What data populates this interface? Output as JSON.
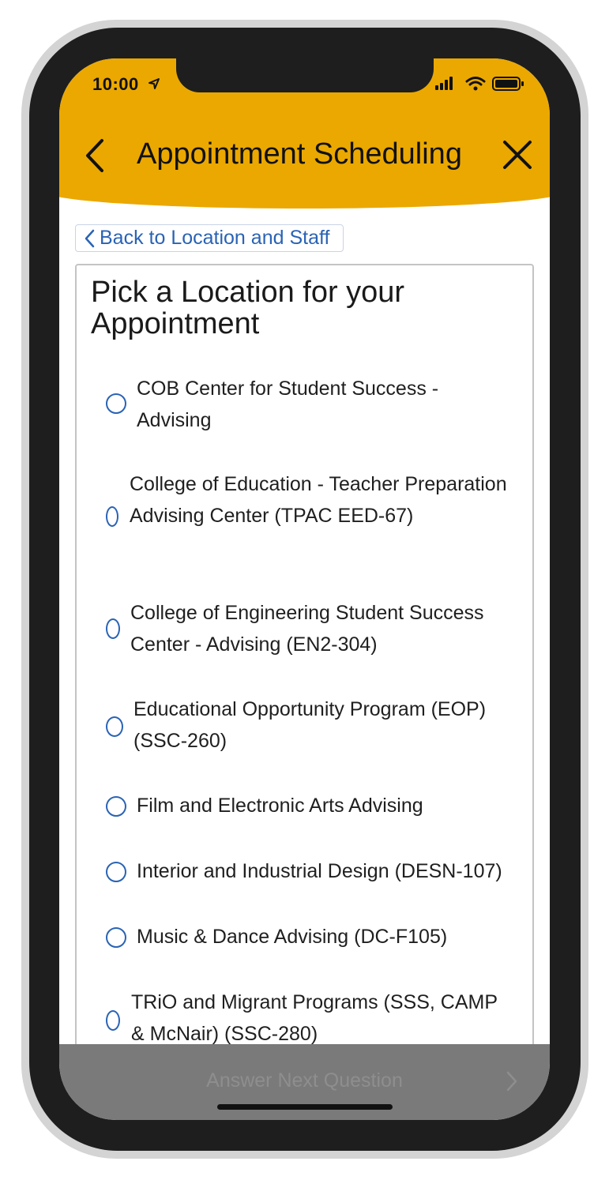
{
  "status_bar": {
    "time": "10:00",
    "icons": [
      "location-arrow-icon",
      "signal-icon",
      "wifi-icon",
      "battery-icon"
    ]
  },
  "header": {
    "title": "Appointment Scheduling",
    "back_icon": "chevron-left-icon",
    "close_icon": "close-icon",
    "background_color": "#eba800"
  },
  "back_link": {
    "label": "Back to Location and Staff"
  },
  "card": {
    "title": "Pick a Location for your Appointment",
    "options": [
      {
        "label": "COB Center for Student Success - Advising",
        "selected": false
      },
      {
        "label": "College of Education - Teacher Preparation Advising Center (TPAC EED-67)",
        "selected": false
      },
      {
        "label": "College of Engineering Student Success Center - Advising (EN2-304)",
        "selected": false
      },
      {
        "label": "Educational Opportunity Program (EOP) (SSC-260)",
        "selected": false
      },
      {
        "label": "Film and Electronic Arts Advising",
        "selected": false
      },
      {
        "label": "Interior and Industrial Design (DESN-107)",
        "selected": false
      },
      {
        "label": "Music & Dance Advising (DC-F105)",
        "selected": false
      },
      {
        "label": "TRiO and Migrant Programs (SSS, CAMP & McNair) (SSC-280)",
        "selected": false
      }
    ]
  },
  "footer": {
    "next_label": "Answer Next Question",
    "next_icon": "chevron-right-icon",
    "enabled": false
  },
  "colors": {
    "accent_blue": "#2a63b5",
    "header_gold": "#eba800",
    "footer_gray": "#7a7a7a"
  }
}
